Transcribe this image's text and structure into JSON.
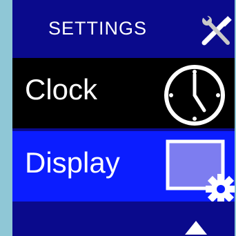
{
  "header": {
    "title": "SETTINGS",
    "icon": "tools-icon"
  },
  "menu": {
    "items": [
      {
        "label": "Clock",
        "icon": "clock-icon",
        "selected": false
      },
      {
        "label": "Display",
        "icon": "display-settings-icon",
        "selected": true
      }
    ]
  },
  "footer": {
    "icon": "up-arrow-icon"
  },
  "colors": {
    "bezel": "#8fc7d6",
    "header_bg": "#0a0a8c",
    "row_bg": "#000000",
    "selected_bg": "#0b1dff",
    "display_square": "#7d7df0"
  }
}
